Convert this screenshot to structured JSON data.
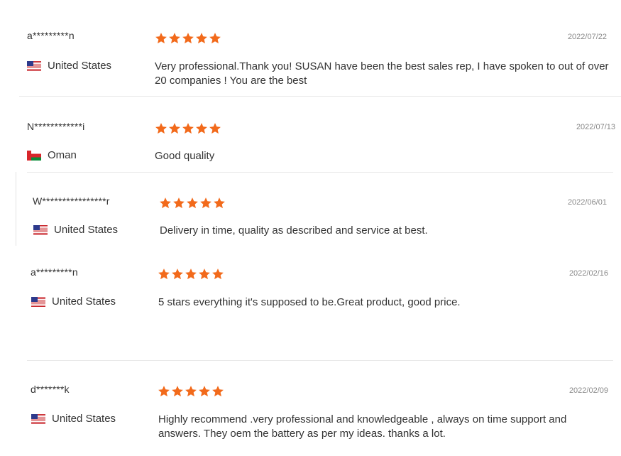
{
  "reviews": [
    {
      "user": "a*********n",
      "country": "United States",
      "flag": "us-flag-icon",
      "rating": 5,
      "date": "2022/07/22",
      "comment": "Very professional.Thank you! SUSAN have been the best sales rep,    I have spoken to out of over 20 companies !    You are the best"
    },
    {
      "user": "N************i",
      "country": "Oman",
      "flag": "oman-flag-icon",
      "rating": 5,
      "date": "2022/07/13",
      "comment": "Good quality"
    },
    {
      "user": "W****************r",
      "country": "United States",
      "flag": "us-flag-icon",
      "rating": 5,
      "date": "2022/06/01",
      "comment": "Delivery in time, quality as described and service at best."
    },
    {
      "user": "a*********n",
      "country": "United States",
      "flag": "us-flag-icon",
      "rating": 5,
      "date": "2022/02/16",
      "comment": "5 stars everything it's supposed to be.Great product, good price."
    },
    {
      "user": "d*******k",
      "country": "United States",
      "flag": "us-flag-icon",
      "rating": 5,
      "date": "2022/02/09",
      "comment": "Highly recommend .very professional and knowledgeable , always on time support and answers. They oem the battery as per my ideas. thanks a lot."
    }
  ],
  "colors": {
    "star": "#f26a1b",
    "date": "#888888",
    "text": "#333333"
  }
}
